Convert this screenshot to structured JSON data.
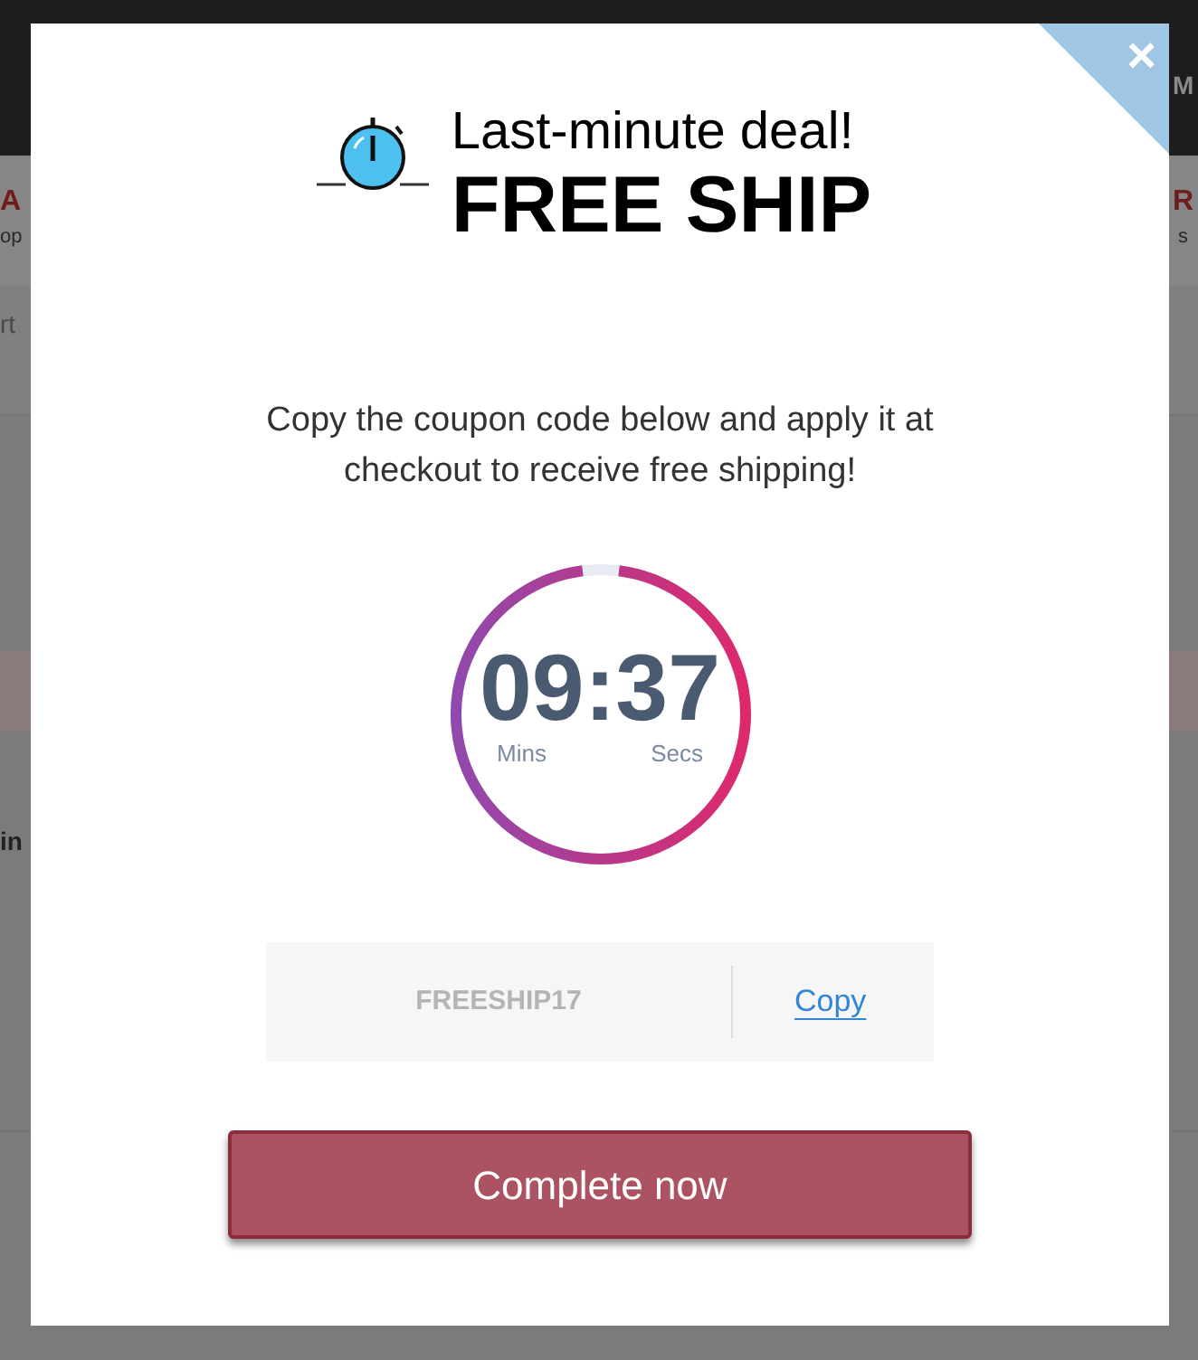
{
  "background_page": {
    "fragments": [
      {
        "text": "M",
        "kind": "logo"
      },
      {
        "text": "A",
        "kind": "heading"
      },
      {
        "text": "R",
        "kind": "heading"
      },
      {
        "text": "op",
        "kind": "sub"
      },
      {
        "text": "s",
        "kind": "sub"
      },
      {
        "text": "rt",
        "kind": "plain"
      },
      {
        "text": "in",
        "kind": "bold"
      }
    ]
  },
  "modal": {
    "close": "×",
    "title": "Last-minute deal!",
    "headline": "FREE SHIP",
    "description": "Copy the coupon code below and apply it at checkout to receive free shipping!",
    "countdown": {
      "minutes": "09",
      "separator": ":",
      "seconds": "37",
      "minutes_label": "Mins",
      "seconds_label": "Secs",
      "level": 0.96
    },
    "coupon": {
      "code": "FREESHIP17",
      "copy_link": "Copy"
    },
    "button": "Complete now"
  }
}
